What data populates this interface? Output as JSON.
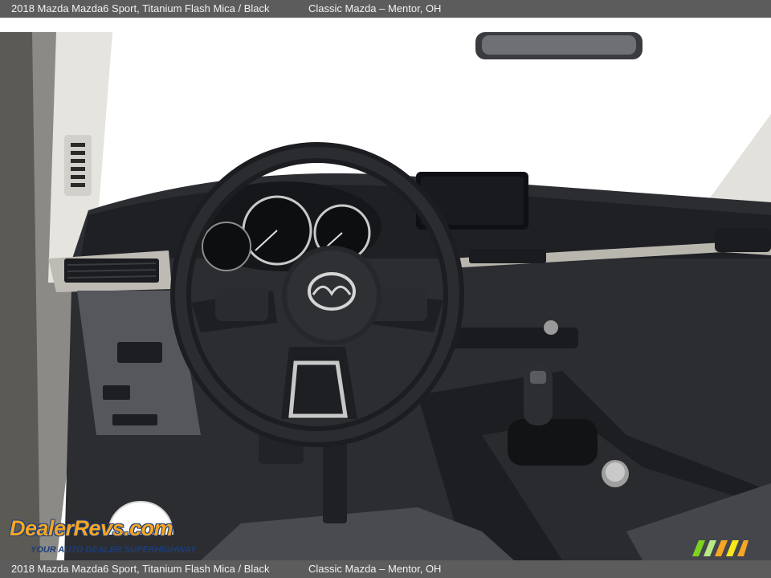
{
  "caption_top": {
    "vehicle": "2018 Mazda Mazda6 Sport,  Titanium Flash Mica / Black",
    "dealer": "Classic Mazda – Mentor, OH"
  },
  "caption_bottom": {
    "vehicle": "2018 Mazda Mazda6 Sport,  Titanium Flash Mica / Black",
    "dealer": "Classic Mazda – Mentor, OH"
  },
  "watermark": {
    "logo_text": "DealerRevs.com",
    "tagline": "YOUR AUTO DEALER SUPERHIGHWAY"
  },
  "colors": {
    "caption_bar": "#5c5c5c",
    "caption_text": "#f2f2f2",
    "dashboard": "#2b2d31",
    "trim_silver": "#b9b6ae",
    "windshield": "#ffffff",
    "watermark_orange": "#f5a623",
    "watermark_navy": "#1c3d7a"
  }
}
